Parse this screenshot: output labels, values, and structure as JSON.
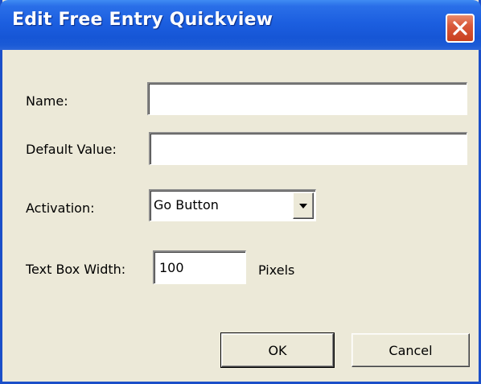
{
  "window": {
    "title": "Edit Free Entry Quickview",
    "close_icon": "close-icon"
  },
  "form": {
    "name": {
      "label": "Name:",
      "value": ""
    },
    "default_value": {
      "label": "Default Value:",
      "value": ""
    },
    "activation": {
      "label": "Activation:",
      "selected": "Go Button",
      "arrow_icon": "chevron-down-icon"
    },
    "text_box_width": {
      "label": "Text Box Width:",
      "value": "100",
      "unit": "Pixels"
    }
  },
  "buttons": {
    "ok": "OK",
    "cancel": "Cancel"
  },
  "colors": {
    "titlebar": "#1c5fe0",
    "face": "#ece9d8",
    "close": "#d9593a"
  }
}
